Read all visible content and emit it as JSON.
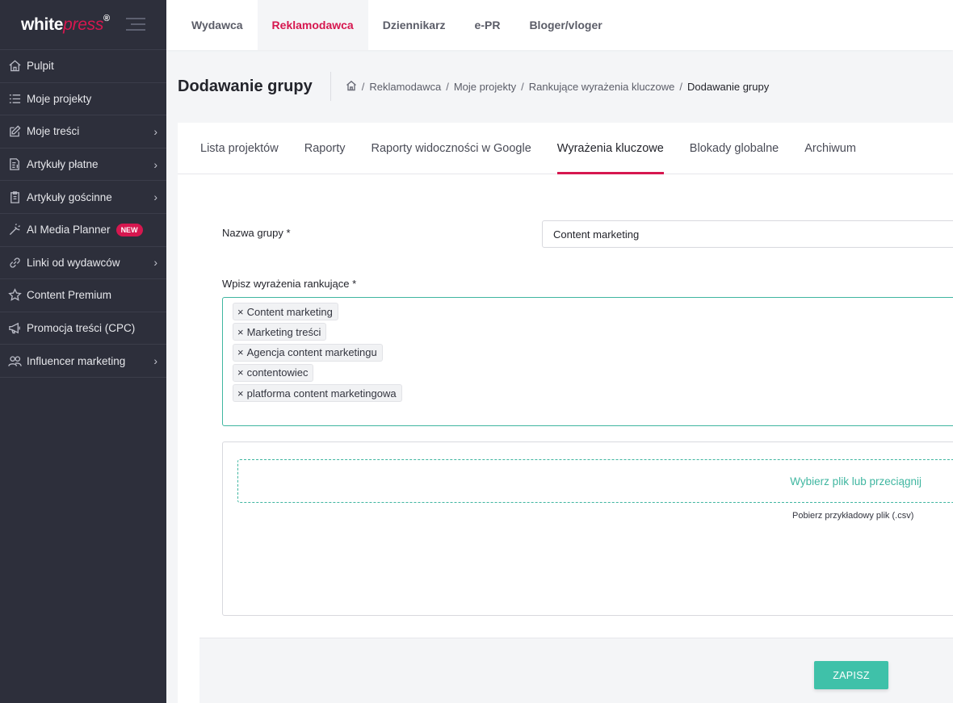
{
  "app": {
    "logo_white": "white",
    "logo_press": "press",
    "logo_reg": "®"
  },
  "sidebar": {
    "items": [
      {
        "label": "Pulpit",
        "icon": "home-icon",
        "chevron": false
      },
      {
        "label": "Moje projekty",
        "icon": "list-icon",
        "chevron": false
      },
      {
        "label": "Moje treści",
        "icon": "edit-icon",
        "chevron": true
      },
      {
        "label": "Artykuły płatne",
        "icon": "paid-article-icon",
        "chevron": true
      },
      {
        "label": "Artykuły gościnne",
        "icon": "clipboard-icon",
        "chevron": true
      },
      {
        "label": "AI Media Planner",
        "icon": "magic-wand-icon",
        "chevron": false,
        "badge": "NEW"
      },
      {
        "label": "Linki od wydawców",
        "icon": "link-icon",
        "chevron": true
      },
      {
        "label": "Content Premium",
        "icon": "star-icon",
        "chevron": false
      },
      {
        "label": "Promocja treści (CPC)",
        "icon": "megaphone-icon",
        "chevron": false
      },
      {
        "label": "Influencer marketing",
        "icon": "users-icon",
        "chevron": true
      }
    ]
  },
  "topbar": {
    "tabs": [
      "Wydawca",
      "Reklamodawca",
      "Dziennikarz",
      "e-PR",
      "Bloger/vloger"
    ],
    "active": "Reklamodawca"
  },
  "header": {
    "title": "Dodawanie grupy",
    "breadcrumb": [
      "Reklamodawca",
      "Moje projekty",
      "Rankujące wyrażenia kluczowe",
      "Dodawanie grupy"
    ],
    "separator": "/"
  },
  "card": {
    "tabs": [
      "Lista projektów",
      "Raporty",
      "Raporty widoczności w Google",
      "Wyrażenia kluczowe",
      "Blokady globalne",
      "Archiwum"
    ],
    "active_tab": "Wyrażenia kluczowe"
  },
  "form": {
    "group_name_label": "Nazwa grupy *",
    "group_name_value": "Content marketing",
    "phrases_label": "Wpisz wyrażenia rankujące *",
    "phrases": [
      "Content marketing",
      "Marketing treści",
      "Agencja content marketingu",
      "contentowiec",
      "platforma content marketingowa"
    ],
    "tag_remove": "×",
    "dropzone_text": "Wybierz plik lub przeciągnij",
    "csv_link": "Pobierz przykładowy plik (.csv)",
    "save_label": "ZAPISZ"
  },
  "colors": {
    "brand": "#d6174f",
    "accent": "#3fc1a9",
    "sidebar_bg": "#2d2f3b"
  }
}
